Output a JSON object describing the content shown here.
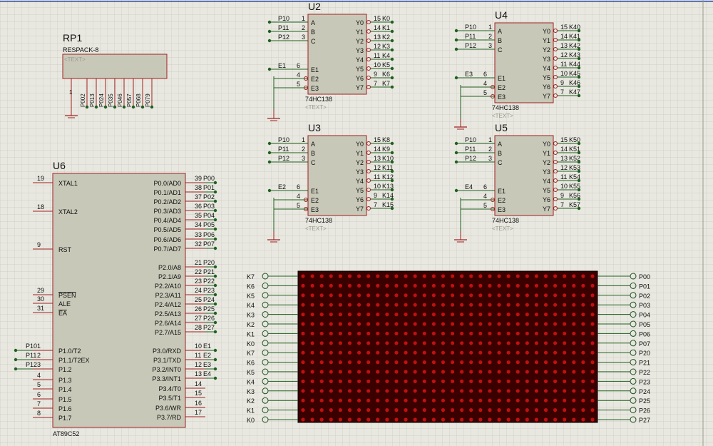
{
  "colors": {
    "background": "#e8e8e0",
    "grid": "#c4c4bc",
    "body": "#c8c8b8",
    "outline": "#a02020",
    "wire": "#206020",
    "text": "#101010",
    "pin": "#7a1010",
    "dim": "#9a9a90",
    "led_off": "#c01010",
    "led_bg": "#3a0000"
  },
  "rp1": {
    "ref": "RP1",
    "part": "RESPACK-8",
    "text": "<TEXT>",
    "pin1": "1",
    "pins": [
      "P002",
      "P013",
      "P024",
      "P035",
      "P046",
      "P057",
      "P068",
      "P079"
    ]
  },
  "decoders": [
    {
      "ref": "U2",
      "part": "74HC138",
      "text": "<TEXT>",
      "inputs": [
        {
          "net": "P10",
          "num": "1",
          "label": "A"
        },
        {
          "net": "P11",
          "num": "2",
          "label": "B"
        },
        {
          "net": "P12",
          "num": "3",
          "label": "C"
        }
      ],
      "enable": [
        {
          "net": "E1",
          "num": "6",
          "label": "E1"
        },
        {
          "net": "",
          "num": "4",
          "label": "E2"
        },
        {
          "net": "",
          "num": "5",
          "label": "E3"
        }
      ],
      "outputs": [
        {
          "num": "15",
          "net": "K0",
          "label": "Y0"
        },
        {
          "num": "14",
          "net": "K1",
          "label": "Y1"
        },
        {
          "num": "13",
          "net": "K2",
          "label": "Y2"
        },
        {
          "num": "12",
          "net": "K3",
          "label": "Y3"
        },
        {
          "num": "11",
          "net": "K4",
          "label": "Y4"
        },
        {
          "num": "10",
          "net": "K5",
          "label": "Y5"
        },
        {
          "num": "9",
          "net": "K6",
          "label": "Y6"
        },
        {
          "num": "7",
          "net": "K7",
          "label": "Y7"
        }
      ]
    },
    {
      "ref": "U3",
      "part": "74HC138",
      "text": "<TEXT>",
      "inputs": [
        {
          "net": "P10",
          "num": "1",
          "label": "A"
        },
        {
          "net": "P11",
          "num": "2",
          "label": "B"
        },
        {
          "net": "P12",
          "num": "3",
          "label": "C"
        }
      ],
      "enable": [
        {
          "net": "E2",
          "num": "6",
          "label": "E1"
        },
        {
          "net": "",
          "num": "4",
          "label": "E2"
        },
        {
          "net": "",
          "num": "5",
          "label": "E3"
        }
      ],
      "outputs": [
        {
          "num": "15",
          "net": "K8",
          "label": "Y0"
        },
        {
          "num": "14",
          "net": "K9",
          "label": "Y1"
        },
        {
          "num": "13",
          "net": "K10",
          "label": "Y2"
        },
        {
          "num": "12",
          "net": "K11",
          "label": "Y3"
        },
        {
          "num": "11",
          "net": "K12",
          "label": "Y4"
        },
        {
          "num": "10",
          "net": "K13",
          "label": "Y5"
        },
        {
          "num": "9",
          "net": "K14",
          "label": "Y6"
        },
        {
          "num": "7",
          "net": "K15",
          "label": "Y7"
        }
      ]
    },
    {
      "ref": "U4",
      "part": "74HC138",
      "text": "<TEXT>",
      "inputs": [
        {
          "net": "P10",
          "num": "1",
          "label": "A"
        },
        {
          "net": "P11",
          "num": "2",
          "label": "B"
        },
        {
          "net": "P12",
          "num": "3",
          "label": "C"
        }
      ],
      "enable": [
        {
          "net": "E3",
          "num": "6",
          "label": "E1"
        },
        {
          "net": "",
          "num": "4",
          "label": "E2"
        },
        {
          "net": "",
          "num": "5",
          "label": "E3"
        }
      ],
      "outputs": [
        {
          "num": "15",
          "net": "K40",
          "label": "Y0"
        },
        {
          "num": "14",
          "net": "K41",
          "label": "Y1"
        },
        {
          "num": "13",
          "net": "K42",
          "label": "Y2"
        },
        {
          "num": "12",
          "net": "K43",
          "label": "Y3"
        },
        {
          "num": "11",
          "net": "K44",
          "label": "Y4"
        },
        {
          "num": "10",
          "net": "K45",
          "label": "Y5"
        },
        {
          "num": "9",
          "net": "K46",
          "label": "Y6"
        },
        {
          "num": "7",
          "net": "K47",
          "label": "Y7"
        }
      ]
    },
    {
      "ref": "U5",
      "part": "74HC138",
      "text": "<TEXT>",
      "inputs": [
        {
          "net": "P10",
          "num": "1",
          "label": "A"
        },
        {
          "net": "P11",
          "num": "2",
          "label": "B"
        },
        {
          "net": "P12",
          "num": "3",
          "label": "C"
        }
      ],
      "enable": [
        {
          "net": "E4",
          "num": "6",
          "label": "E1"
        },
        {
          "net": "",
          "num": "4",
          "label": "E2"
        },
        {
          "net": "",
          "num": "5",
          "label": "E3"
        }
      ],
      "outputs": [
        {
          "num": "15",
          "net": "K50",
          "label": "Y0"
        },
        {
          "num": "14",
          "net": "K51",
          "label": "Y1"
        },
        {
          "num": "13",
          "net": "K52",
          "label": "Y2"
        },
        {
          "num": "12",
          "net": "K53",
          "label": "Y3"
        },
        {
          "num": "11",
          "net": "K54",
          "label": "Y4"
        },
        {
          "num": "10",
          "net": "K55",
          "label": "Y5"
        },
        {
          "num": "9",
          "net": "K56",
          "label": "Y6"
        },
        {
          "num": "7",
          "net": "K57",
          "label": "Y7"
        }
      ]
    }
  ],
  "mcu": {
    "ref": "U6",
    "part": "AT89C52",
    "left": [
      {
        "num": "19",
        "label": "XTAL1",
        "net": ""
      },
      {
        "num": "18",
        "label": "XTAL2",
        "net": ""
      },
      {
        "num": "9",
        "label": "RST",
        "net": ""
      },
      {
        "num": "29",
        "label": "PSEN",
        "net": "",
        "bar": true
      },
      {
        "num": "30",
        "label": "ALE",
        "net": ""
      },
      {
        "num": "31",
        "label": "EA",
        "net": "",
        "bar": true
      },
      {
        "num": "1",
        "label": "P1.0/T2",
        "net": "P10"
      },
      {
        "num": "2",
        "label": "P1.1/T2EX",
        "net": "P11"
      },
      {
        "num": "3",
        "label": "P1.2",
        "net": "P12"
      },
      {
        "num": "4",
        "label": "P1.3",
        "net": ""
      },
      {
        "num": "5",
        "label": "P1.4",
        "net": ""
      },
      {
        "num": "6",
        "label": "P1.5",
        "net": ""
      },
      {
        "num": "7",
        "label": "P1.6",
        "net": ""
      },
      {
        "num": "8",
        "label": "P1.7",
        "net": ""
      }
    ],
    "right": [
      {
        "num": "39",
        "label": "P0.0/AD0",
        "net": "P00"
      },
      {
        "num": "38",
        "label": "P0.1/AD1",
        "net": "P01"
      },
      {
        "num": "37",
        "label": "P0.2/AD2",
        "net": "P02"
      },
      {
        "num": "36",
        "label": "P0.3/AD3",
        "net": "P03"
      },
      {
        "num": "35",
        "label": "P0.4/AD4",
        "net": "P04"
      },
      {
        "num": "34",
        "label": "P0.5/AD5",
        "net": "P05"
      },
      {
        "num": "33",
        "label": "P0.6/AD6",
        "net": "P06"
      },
      {
        "num": "32",
        "label": "P0.7/AD7",
        "net": "P07"
      },
      {
        "num": "21",
        "label": "P2.0/A8",
        "net": "P20"
      },
      {
        "num": "22",
        "label": "P2.1/A9",
        "net": "P21"
      },
      {
        "num": "23",
        "label": "P2.2/A10",
        "net": "P22"
      },
      {
        "num": "24",
        "label": "P2.3/A11",
        "net": "P23"
      },
      {
        "num": "25",
        "label": "P2.4/A12",
        "net": "P24"
      },
      {
        "num": "26",
        "label": "P2.5/A13",
        "net": "P25"
      },
      {
        "num": "27",
        "label": "P2.6/A14",
        "net": "P26"
      },
      {
        "num": "28",
        "label": "P2.7/A15",
        "net": "P27"
      },
      {
        "num": "10",
        "label": "P3.0/RXD",
        "net": "E1"
      },
      {
        "num": "11",
        "label": "P3.1/TXD",
        "net": "E2"
      },
      {
        "num": "12",
        "label": "P3.2/INT0",
        "net": "E3"
      },
      {
        "num": "13",
        "label": "P3.3/INT1",
        "net": "E4"
      },
      {
        "num": "14",
        "label": "P3.4/T0",
        "net": ""
      },
      {
        "num": "15",
        "label": "P3.5/T1",
        "net": ""
      },
      {
        "num": "16",
        "label": "P3.6/WR",
        "net": ""
      },
      {
        "num": "17",
        "label": "P3.7/RD",
        "net": ""
      }
    ]
  },
  "matrix": {
    "left_labels": [
      "K7",
      "K6",
      "K5",
      "K4",
      "K3",
      "K2",
      "K1",
      "K0",
      "K7",
      "K6",
      "K5",
      "K4",
      "K3",
      "K2",
      "K1",
      "K0"
    ],
    "right_labels": [
      "P00",
      "P01",
      "P02",
      "P03",
      "P04",
      "P05",
      "P06",
      "P07",
      "P20",
      "P21",
      "P22",
      "P23",
      "P24",
      "P25",
      "P26",
      "P27"
    ],
    "cols": 32,
    "rows": 16
  }
}
